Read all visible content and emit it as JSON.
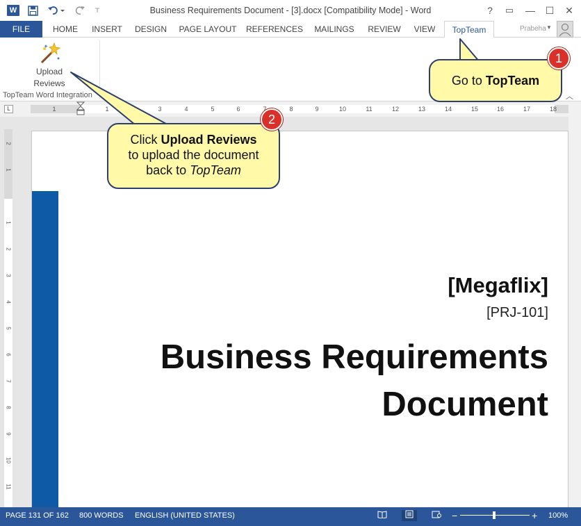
{
  "window": {
    "title": "Business Requirements Document - [3].docx [Compatibility Mode] - Word",
    "help_label": "?",
    "restore_label": "▭",
    "minimize_label": "—",
    "maximize_label": "☐",
    "close_label": "✕"
  },
  "quick_access": {
    "app_icon": "W",
    "save_icon": "save-icon",
    "undo_icon": "undo-icon",
    "redo_icon": "redo-icon"
  },
  "ribbon": {
    "tabs": [
      {
        "label": "FILE"
      },
      {
        "label": "HOME"
      },
      {
        "label": "INSERT"
      },
      {
        "label": "DESIGN"
      },
      {
        "label": "PAGE LAYOUT"
      },
      {
        "label": "REFERENCES"
      },
      {
        "label": "MAILINGS"
      },
      {
        "label": "REVIEW"
      },
      {
        "label": "VIEW"
      },
      {
        "label": "TopTeam"
      }
    ],
    "active_tab": "TopTeam",
    "user_name": "Prabeha D...",
    "upload_button": {
      "line1": "Upload",
      "line2": "Reviews"
    },
    "group_label": "TopTeam Word Integration"
  },
  "ruler": {
    "numbers": [
      "1",
      "1",
      "2",
      "3",
      "4",
      "5",
      "6",
      "7",
      "8",
      "9",
      "10",
      "11",
      "12",
      "13",
      "14",
      "15",
      "16",
      "17",
      "18"
    ],
    "vertical_numbers": [
      "2",
      "1",
      "1",
      "2",
      "3",
      "4",
      "5",
      "6",
      "7",
      "8",
      "9",
      "10",
      "11"
    ]
  },
  "document": {
    "company": "[Megaflix]",
    "project_code": "[PRJ-101]",
    "title_line1": "Business Requirements",
    "title_line2": "Document"
  },
  "statusbar": {
    "page": "PAGE 131 OF 162",
    "words": "800 WORDS",
    "language": "ENGLISH (UNITED STATES)",
    "zoom": "100%",
    "zoom_minus": "−",
    "zoom_plus": "+"
  },
  "callouts": {
    "step1": {
      "badge": "1",
      "prefix": "Go to ",
      "bold": "TopTeam"
    },
    "step2": {
      "badge": "2",
      "prefix": "Click ",
      "bold": "Upload Reviews",
      "line2": "to upload the document",
      "line3_prefix": "back to ",
      "line3_italic": "TopTeam"
    }
  },
  "colors": {
    "word_blue": "#2b579a",
    "callout_fill": "#fff9a8",
    "badge_red": "#d9302a",
    "cover_bar": "#0f5aa6"
  }
}
